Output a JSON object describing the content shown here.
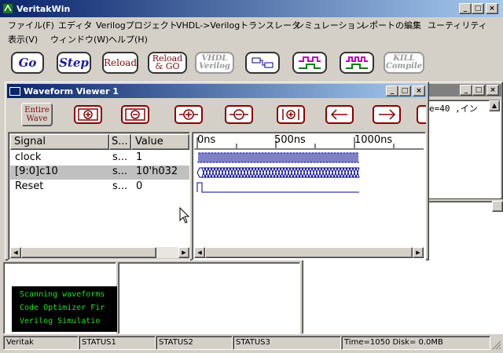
{
  "window": {
    "title": "VeritakWin"
  },
  "menu": {
    "row1": [
      "ファイル(F)",
      "エディタ",
      "Verilogプロジェクト",
      "VHDL->Verilogトランスレータ",
      "シミュレーション",
      "レポートの編集",
      "ユーティリティ"
    ],
    "row2": [
      "表示(V)",
      "ウィンドウ(W)",
      "ヘルプ(H)"
    ]
  },
  "toolbar": {
    "go": "Go",
    "step": "Step",
    "reload": "Reload",
    "reload_go_1": "Reload",
    "reload_go_2": "& GO",
    "vhdl_1": "VHDL",
    "vhdl_2": "Verilog",
    "kill_1": "KILL",
    "kill_2": "Compile"
  },
  "waveform_viewer": {
    "title": "Waveform Viewer 1",
    "entire_wave_1": "Entire",
    "entire_wave_2": "Wave",
    "columns": {
      "signal": "Signal",
      "s": "S...",
      "value": "Value"
    },
    "signals": [
      {
        "name": "clock",
        "s": "s...",
        "value": "1"
      },
      {
        "name": "[9:0]c10",
        "s": "s...",
        "value": "10'h032"
      },
      {
        "name": "Reset",
        "s": "s...",
        "value": "0"
      }
    ],
    "time_ticks": [
      "0ns",
      "500ns",
      "1000ns"
    ]
  },
  "editor_snippet": "e=40 ,イン",
  "console_lines": [
    "Scanning waveforms",
    "Code Optimizer Fir",
    "Verilog  Simulatio"
  ],
  "status": {
    "s0": "Veritak",
    "s1": "STATUS1",
    "s2": "STATUS2",
    "s3": "STATUS3",
    "s4": "Time=1050 Disk= 0.0MB"
  }
}
